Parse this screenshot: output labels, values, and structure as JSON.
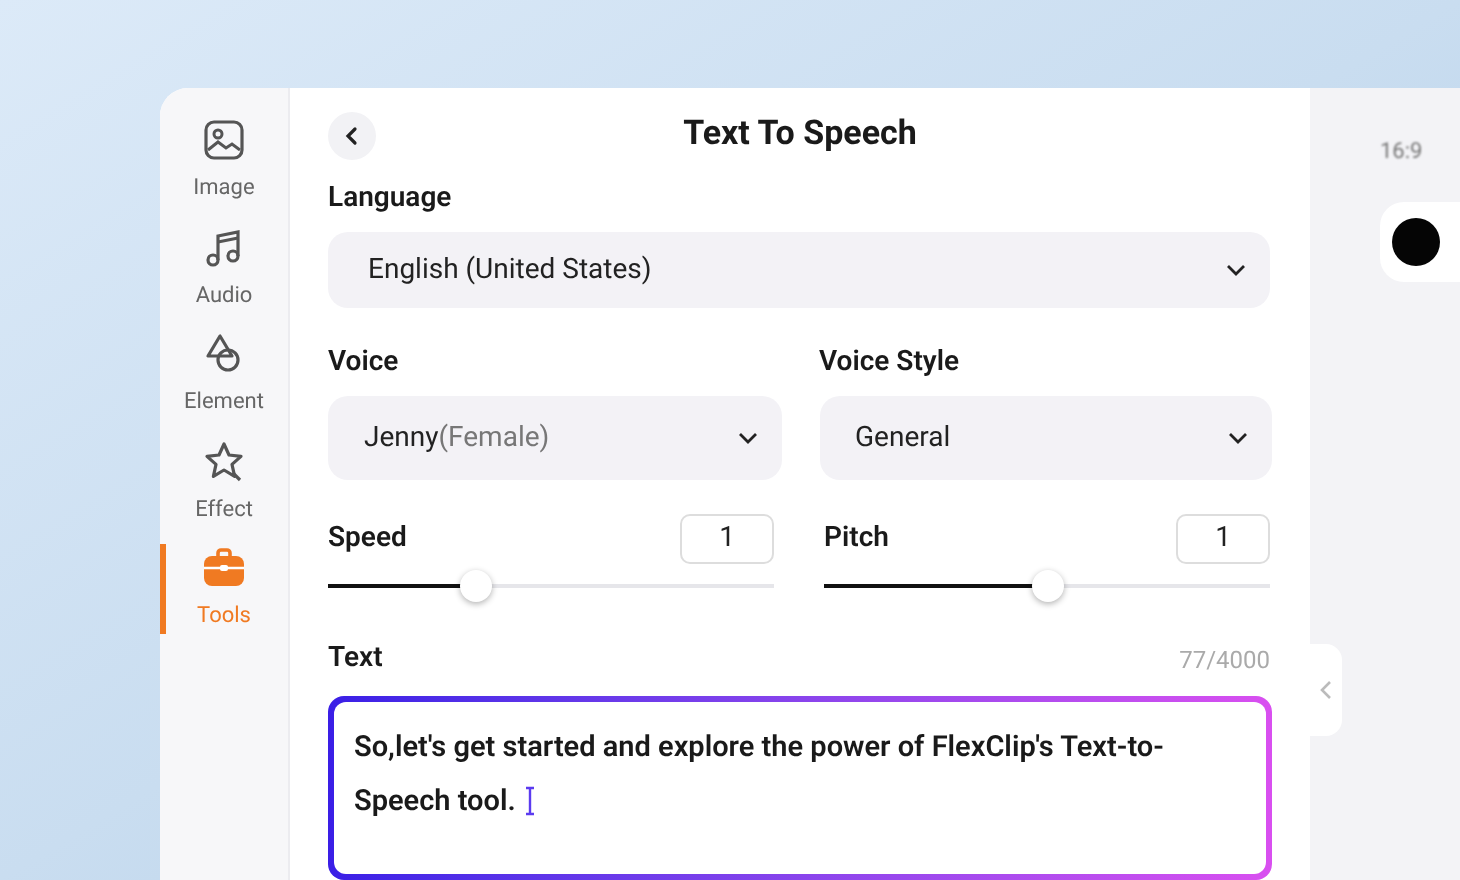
{
  "sidebar": {
    "items": [
      {
        "label": "Image",
        "kind": "image",
        "selected": false
      },
      {
        "label": "Audio",
        "kind": "audio",
        "selected": false
      },
      {
        "label": "Element",
        "kind": "element",
        "selected": false
      },
      {
        "label": "Effect",
        "kind": "effect",
        "selected": false
      },
      {
        "label": "Tools",
        "kind": "tools",
        "selected": true
      }
    ]
  },
  "panel": {
    "title": "Text To Speech",
    "language": {
      "label": "Language",
      "value": "English (United States)"
    },
    "voice": {
      "label": "Voice",
      "value": "Jenny",
      "detail": "(Female)"
    },
    "voice_style": {
      "label": "Voice Style",
      "value": "General"
    },
    "sliders": [
      {
        "label": "Speed",
        "value": "1",
        "level": 0.33
      },
      {
        "label": "Pitch",
        "value": "1",
        "level": 0.5
      }
    ],
    "text": {
      "label": "Text",
      "counter": "77/4000",
      "value": "So,let's get started and explore the power of FlexClip's Text-to-Speech tool."
    }
  },
  "preview": {
    "ratio": "16:9"
  }
}
